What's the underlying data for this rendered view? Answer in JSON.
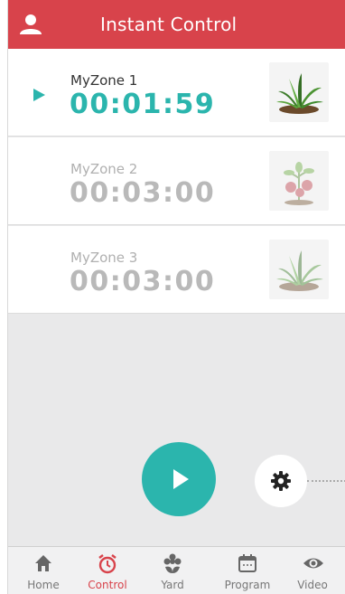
{
  "header": {
    "title": "Instant Control",
    "user_icon": "user-icon"
  },
  "zones": [
    {
      "name": "MyZone 1",
      "time": "00:01:59",
      "active": true,
      "thumb_icon": "plant-icon"
    },
    {
      "name": "MyZone 2",
      "time": "00:03:00",
      "active": false,
      "thumb_icon": "vegetable-plant-icon"
    },
    {
      "name": "MyZone 3",
      "time": "00:03:00",
      "active": false,
      "thumb_icon": "plant-icon"
    }
  ],
  "controls": {
    "run_icon": "play-icon",
    "settings_icon": "gear-icon"
  },
  "tabs": [
    {
      "label": "Home",
      "icon": "home-icon",
      "active": false
    },
    {
      "label": "Control",
      "icon": "alarm-clock-icon",
      "active": true
    },
    {
      "label": "Yard",
      "icon": "flower-icon",
      "active": false
    },
    {
      "label": "Program",
      "icon": "calendar-icon",
      "active": false
    },
    {
      "label": "Video",
      "icon": "eye-icon",
      "active": false
    }
  ],
  "colors": {
    "accent": "#2bb5ad",
    "brand": "#d8434b",
    "inactive_text": "#b9b9b9"
  }
}
